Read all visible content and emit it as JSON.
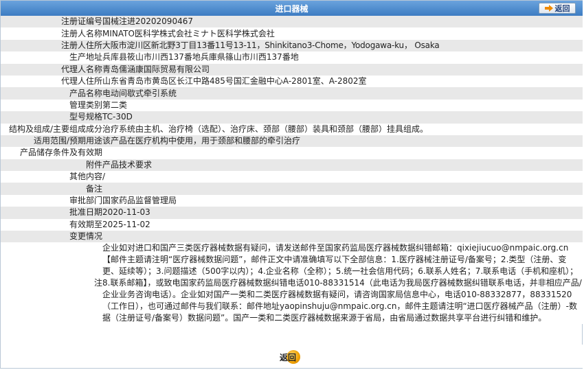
{
  "header": {
    "title": "进口器械",
    "back_label": "返回"
  },
  "rows": [
    {
      "label": "注册证编号",
      "value": "国械注进20202090467"
    },
    {
      "label": "注册人名称",
      "value": "MINATO医科学株式会社ミナト医科学株式会社"
    },
    {
      "label": "注册人住所",
      "value": "大阪市淀川区新北野3丁目13番11号13-11，Shinkitano3-Chome，Yodogawa-ku， Osaka"
    },
    {
      "label": "生产地址",
      "value": "兵库县筱山市川西137番地兵庫県篠山市川西137番地"
    },
    {
      "label": "代理人名称",
      "value": "青岛儒涵康国际贸易有限公司"
    },
    {
      "label": "代理人住所",
      "value": "山东省青岛市黄岛区长江中路485号国汇金融中心A-2801室、A-2802室"
    },
    {
      "label": "产品名称",
      "value": "电动间歇式牵引系统"
    },
    {
      "label": "管理类别",
      "value": "第二类"
    },
    {
      "label": "型号规格",
      "value": "TC-30D"
    },
    {
      "label": "结构及组成/主要组成成分",
      "value": "治疗系统由主机、治疗椅（选配）、治疗床、颈部（腰部）装具和颈部（腰部）挂具组成。"
    },
    {
      "label": "适用范围/预期用途",
      "value": "该产品在医疗机构中使用，用于颈部和腰部的牵引治疗"
    },
    {
      "label": "产品储存条件及有效期",
      "value": ""
    },
    {
      "label": "附件",
      "value": "产品技术要求"
    },
    {
      "label": "其他内容",
      "value": "/"
    },
    {
      "label": "备注",
      "value": ""
    },
    {
      "label": "审批部门",
      "value": "国家药品监督管理局"
    },
    {
      "label": "批准日期",
      "value": "2020-11-03"
    },
    {
      "label": "有效期至",
      "value": "2025-11-02"
    },
    {
      "label": "变更情况",
      "value": ""
    }
  ],
  "note": {
    "label": "注",
    "text": "企业如对进口和国产三类医疗器械数据有疑问，请发送邮件至国家药监局医疗器械数据纠错邮箱：qixiejiucuo@nmpaic.org.cn【邮件主题请注明“医疗器械数据问题”，邮件正文中请准确填写以下全部信息：1.医疗器械注册证号/备案号；2.类型（注册、变更、延续等）；3.问题描述（500字以内）；4.企业名称（全称）；5.统一社会信用代码；6.联系人姓名；7.联系电话（手机和座机）；8.联系邮箱】，或致电国家药监局医疗器械数据纠错电话010-88331514（此电话为我局医疗器械数据纠错联系电话，并非相应产品/企业业务咨询电话）。企业如对国产一类和二类医疗器械数据有疑问，请咨询国家局信息中心，电话010-88332877，88331520（工作日），也可通过邮件与我们联系：邮件地址yaopinshuju@nmpaic.org.cn，邮件主题请注明“进口医疗器械产品（注册）-数据（注册证号/备案号）数据问题”。国产一类和二类医疗器械数据来源于省局，由省局通过数据共享平台进行纠错和维护。"
  },
  "footer": {
    "back_label": "返回"
  },
  "colors": {
    "header_bg": "#3d7cc2",
    "row_odd": "#e8e8e8",
    "row_even": "#ffffff",
    "accent": "#f08a00"
  }
}
